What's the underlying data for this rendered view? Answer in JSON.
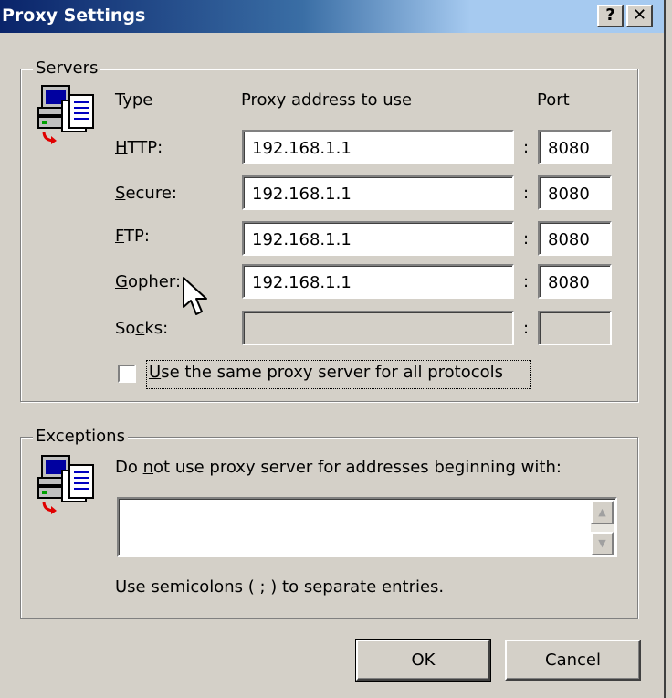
{
  "window": {
    "title": "Proxy Settings",
    "help_label": "?",
    "close_label": "✕"
  },
  "servers": {
    "group_label": "Servers",
    "icon": "computer-network-icon",
    "headers": {
      "type": "Type",
      "address": "Proxy address to use",
      "port": "Port"
    },
    "rows": [
      {
        "label_pre": "",
        "label_key": "H",
        "label_post": "TTP:",
        "address": "192.168.1.1",
        "port": "8080"
      },
      {
        "label_pre": "",
        "label_key": "S",
        "label_post": "ecure:",
        "address": "192.168.1.1",
        "port": "8080"
      },
      {
        "label_pre": "",
        "label_key": "F",
        "label_post": "TP:",
        "address": "192.168.1.1",
        "port": "8080"
      },
      {
        "label_pre": "",
        "label_key": "G",
        "label_post": "opher:",
        "address": "192.168.1.1",
        "port": "8080"
      },
      {
        "label_pre": "So",
        "label_key": "c",
        "label_post": "ks:",
        "address": "",
        "port": ""
      }
    ],
    "colon": ":",
    "same_proxy": {
      "key": "U",
      "rest": "se the same proxy server for all protocols",
      "checked": false
    }
  },
  "exceptions": {
    "group_label": "Exceptions",
    "icon": "computer-network-icon",
    "desc_pre": "Do ",
    "desc_key": "n",
    "desc_post": "ot use proxy server for addresses beginning with:",
    "value": "",
    "hint": "Use semicolons ( ; ) to separate entries."
  },
  "buttons": {
    "ok": "OK",
    "cancel": "Cancel"
  },
  "colors": {
    "face": "#d4d0c8",
    "title_start": "#0a246a",
    "title_end": "#a6caf0"
  }
}
